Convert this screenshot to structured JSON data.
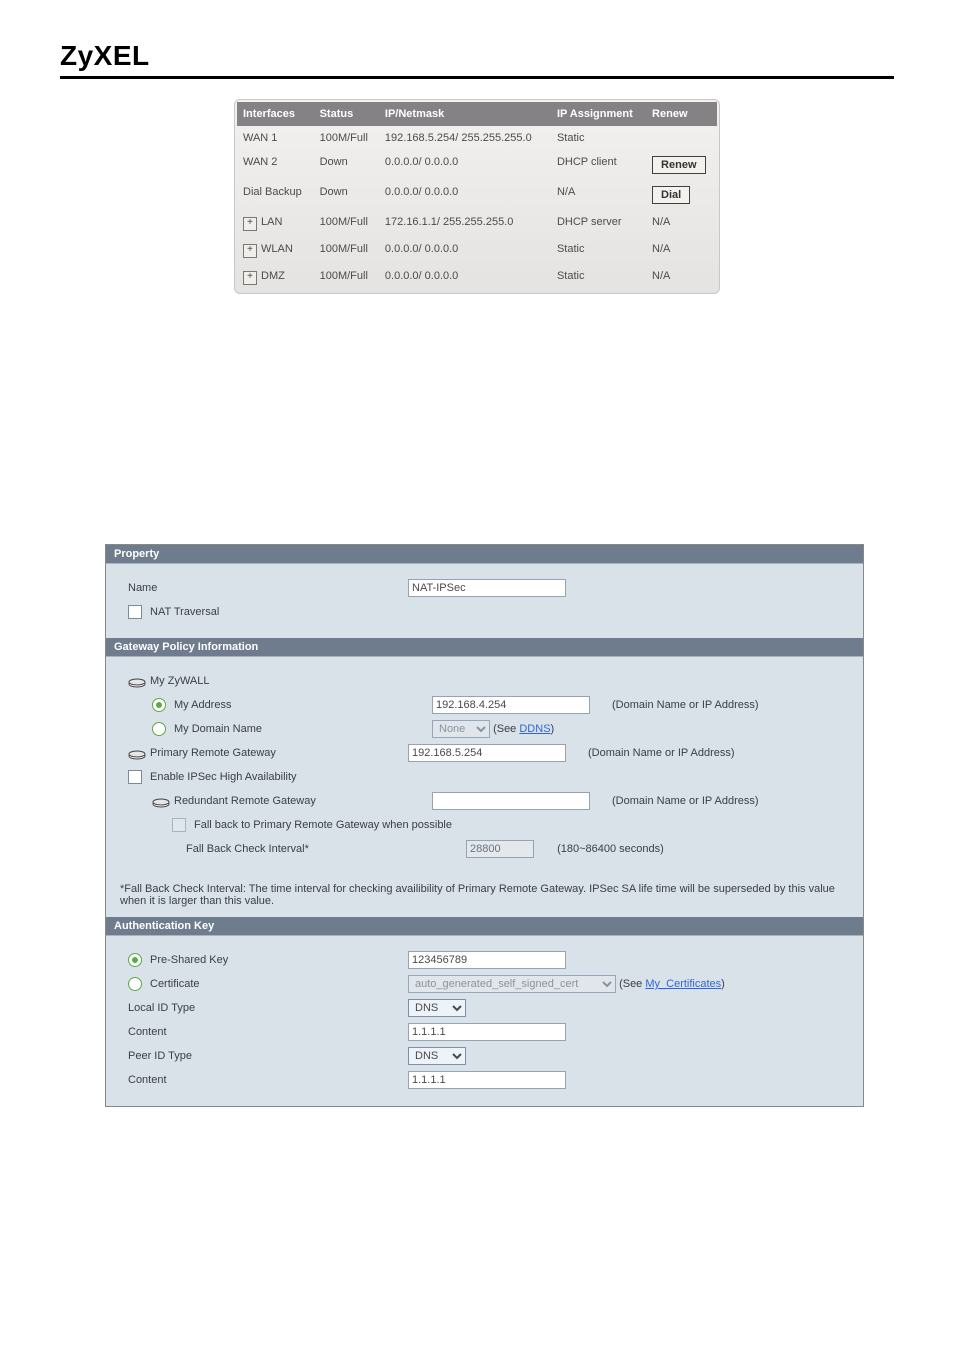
{
  "brand": "ZyXEL",
  "interfaces_table": {
    "headers": [
      "Interfaces",
      "Status",
      "IP/Netmask",
      "IP Assignment",
      "Renew"
    ],
    "rows": [
      {
        "interface": "WAN 1",
        "expandable": false,
        "status": "100M/Full",
        "ip_netmask": "192.168.5.254/ 255.255.255.0",
        "assignment": "Static",
        "action": ""
      },
      {
        "interface": "WAN 2",
        "expandable": false,
        "status": "Down",
        "ip_netmask": "0.0.0.0/ 0.0.0.0",
        "assignment": "DHCP client",
        "action": "Renew"
      },
      {
        "interface": "Dial Backup",
        "expandable": false,
        "status": "Down",
        "ip_netmask": "0.0.0.0/ 0.0.0.0",
        "assignment": "N/A",
        "action": "Dial"
      },
      {
        "interface": "LAN",
        "expandable": true,
        "status": "100M/Full",
        "ip_netmask": "172.16.1.1/ 255.255.255.0",
        "assignment": "DHCP server",
        "action": "N/A"
      },
      {
        "interface": "WLAN",
        "expandable": true,
        "status": "100M/Full",
        "ip_netmask": "0.0.0.0/ 0.0.0.0",
        "assignment": "Static",
        "action": "N/A"
      },
      {
        "interface": "DMZ",
        "expandable": true,
        "status": "100M/Full",
        "ip_netmask": "0.0.0.0/ 0.0.0.0",
        "assignment": "Static",
        "action": "N/A"
      }
    ]
  },
  "property": {
    "header": "Property",
    "name_label": "Name",
    "name_value": "NAT-IPSec",
    "nat_traversal_label": "NAT Traversal"
  },
  "gateway": {
    "header": "Gateway Policy Information",
    "my_zywall_label": "My ZyWALL",
    "my_address_label": "My Address",
    "my_address_value": "192.168.4.254",
    "my_address_hint": "(Domain Name or IP Address)",
    "my_domain_name_label": "My Domain Name",
    "my_domain_name_value": "None",
    "my_domain_name_hint_prefix": "(See ",
    "my_domain_name_hint_link": "DDNS",
    "my_domain_name_hint_suffix": ")",
    "primary_remote_gw_label": "Primary Remote Gateway",
    "primary_remote_gw_value": "192.168.5.254",
    "primary_remote_gw_hint": "(Domain Name or IP Address)",
    "enable_ipsec_ha_label": "Enable IPSec High Availability",
    "redundant_remote_gw_label": "Redundant Remote Gateway",
    "redundant_remote_gw_value": "",
    "redundant_remote_gw_hint": "(Domain Name or IP Address)",
    "fallback_label": "Fall back to Primary Remote Gateway when possible",
    "fallback_interval_label": "Fall Back Check Interval*",
    "fallback_interval_value": "28800",
    "fallback_interval_hint": "(180~86400 seconds)",
    "footnote": "*Fall Back Check Interval: The time interval for checking availibility of Primary Remote Gateway. IPSec SA life time will be superseded by this value when it is larger than this value."
  },
  "auth": {
    "header": "Authentication Key",
    "psk_label": "Pre-Shared Key",
    "psk_value": "123456789",
    "cert_label": "Certificate",
    "cert_value": "auto_generated_self_signed_cert",
    "cert_hint_prefix": "(See ",
    "cert_hint_link": "My_Certificates",
    "cert_hint_suffix": ")",
    "local_id_type_label": "Local ID Type",
    "local_id_type_value": "DNS",
    "local_content_label": "Content",
    "local_content_value": "1.1.1.1",
    "peer_id_type_label": "Peer ID Type",
    "peer_id_type_value": "DNS",
    "peer_content_label": "Content",
    "peer_content_value": "1.1.1.1"
  }
}
